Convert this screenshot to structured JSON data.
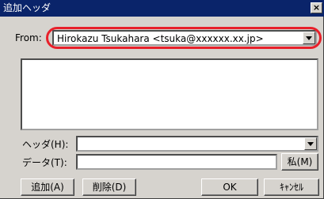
{
  "window": {
    "title": "追加ヘッダ",
    "close_label": "×"
  },
  "from": {
    "label": "From:",
    "value": "Hirokazu Tsukahara <tsuka@xxxxxx.xx.jp>"
  },
  "header_field": {
    "label": "ヘッダ(H):",
    "value": ""
  },
  "data_field": {
    "label": "データ(T):",
    "value": "",
    "private_button": "私(M)"
  },
  "buttons": {
    "add": "追加(A)",
    "delete": "削除(D)",
    "ok": "OK",
    "cancel": "ｷｬﾝｾﾙ"
  },
  "colors": {
    "highlight": "#e8202a",
    "titlebar": "#0a246a",
    "desktop": "#4fb089"
  }
}
